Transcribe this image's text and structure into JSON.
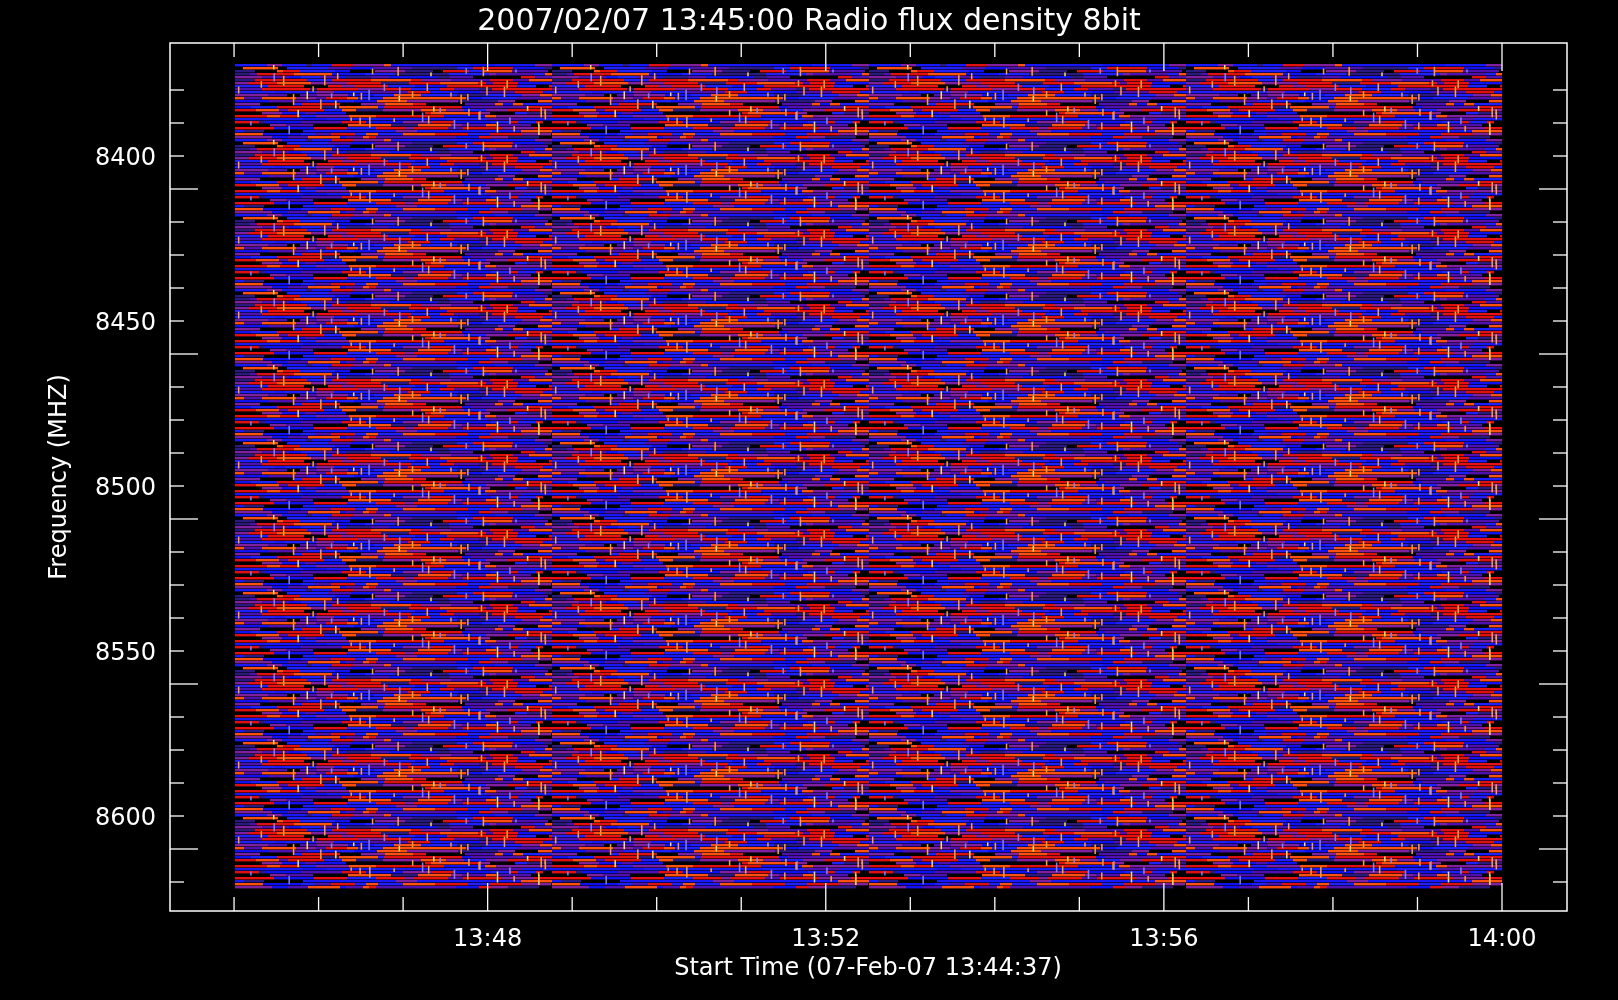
{
  "title": "2007/02/07 13:45:00 Radio flux density 8bit",
  "y_axis": {
    "label": "Frequency (MHZ)",
    "ticks": [
      "8400",
      "8450",
      "8500",
      "8550",
      "8600"
    ]
  },
  "x_axis": {
    "label": "Start Time (07-Feb-07 13:44:37)",
    "ticks": [
      "13:48",
      "13:52",
      "13:56",
      "14:00"
    ]
  }
}
